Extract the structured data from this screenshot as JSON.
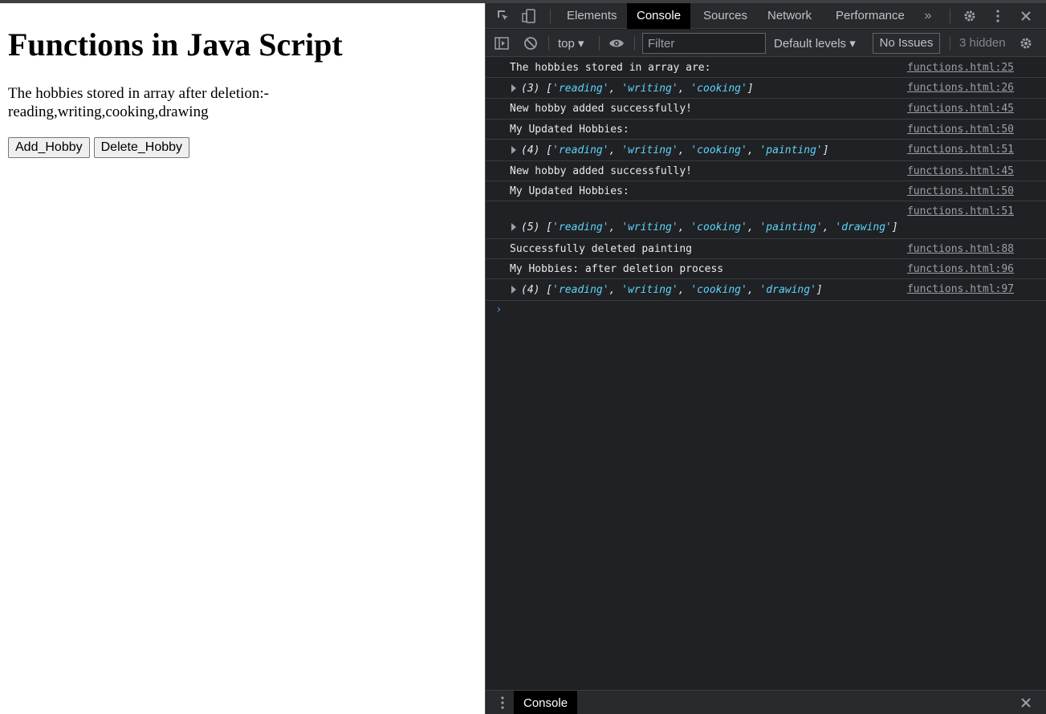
{
  "page": {
    "title": "Functions in Java Script",
    "para_line1": "The hobbies stored in array after deletion:-",
    "para_line2": "reading,writing,cooking,drawing",
    "buttons": {
      "add": "Add_Hobby",
      "delete": "Delete_Hobby"
    }
  },
  "devtools": {
    "tabs": [
      "Elements",
      "Console",
      "Sources",
      "Network",
      "Performance"
    ],
    "active_tab": "Console",
    "toolbar": {
      "context": "top",
      "filter_placeholder": "Filter",
      "levels": "Default levels",
      "issues": "No Issues",
      "hidden": "3 hidden"
    },
    "console_rows": [
      {
        "text": "The hobbies stored in array are:",
        "source": "functions.html:25"
      },
      {
        "count": "(3)",
        "items": [
          "'reading'",
          "'writing'",
          "'cooking'"
        ],
        "source": "functions.html:26"
      },
      {
        "text": "New hobby added successfully!",
        "source": "functions.html:45"
      },
      {
        "text": "My Updated Hobbies:",
        "source": "functions.html:50"
      },
      {
        "count": "(4)",
        "items": [
          "'reading'",
          "'writing'",
          "'cooking'",
          "'painting'"
        ],
        "source": "functions.html:51"
      },
      {
        "text": "New hobby added successfully!",
        "source": "functions.html:45"
      },
      {
        "text": "My Updated Hobbies:",
        "source": "functions.html:50"
      },
      {
        "count": "(5)",
        "items": [
          "'reading'",
          "'writing'",
          "'cooking'",
          "'painting'",
          "'drawing'"
        ],
        "source": "functions.html:51"
      },
      {
        "text": "Successfully deleted painting",
        "source": "functions.html:88"
      },
      {
        "text": "My Hobbies: after deletion process",
        "source": "functions.html:96"
      },
      {
        "count": "(4)",
        "items": [
          "'reading'",
          "'writing'",
          "'cooking'",
          "'drawing'"
        ],
        "source": "functions.html:97"
      }
    ],
    "prompt": "›",
    "drawer_tab": "Console"
  },
  "colors": {
    "devtools_bg": "#202124",
    "toolbar_bg": "#292a2d",
    "string_value": "#5cd5fb",
    "prompt": "#4d8bf5"
  },
  "icons": {
    "inspect": "inspect-element-icon",
    "device": "device-toolbar-icon",
    "more_tabs": "chevron-double-right-icon",
    "settings": "gear-icon",
    "menu": "kebab-menu-icon",
    "close": "close-icon",
    "sidebar": "sidebar-toggle-icon",
    "clear": "clear-console-icon",
    "eye": "live-expression-eye-icon"
  }
}
